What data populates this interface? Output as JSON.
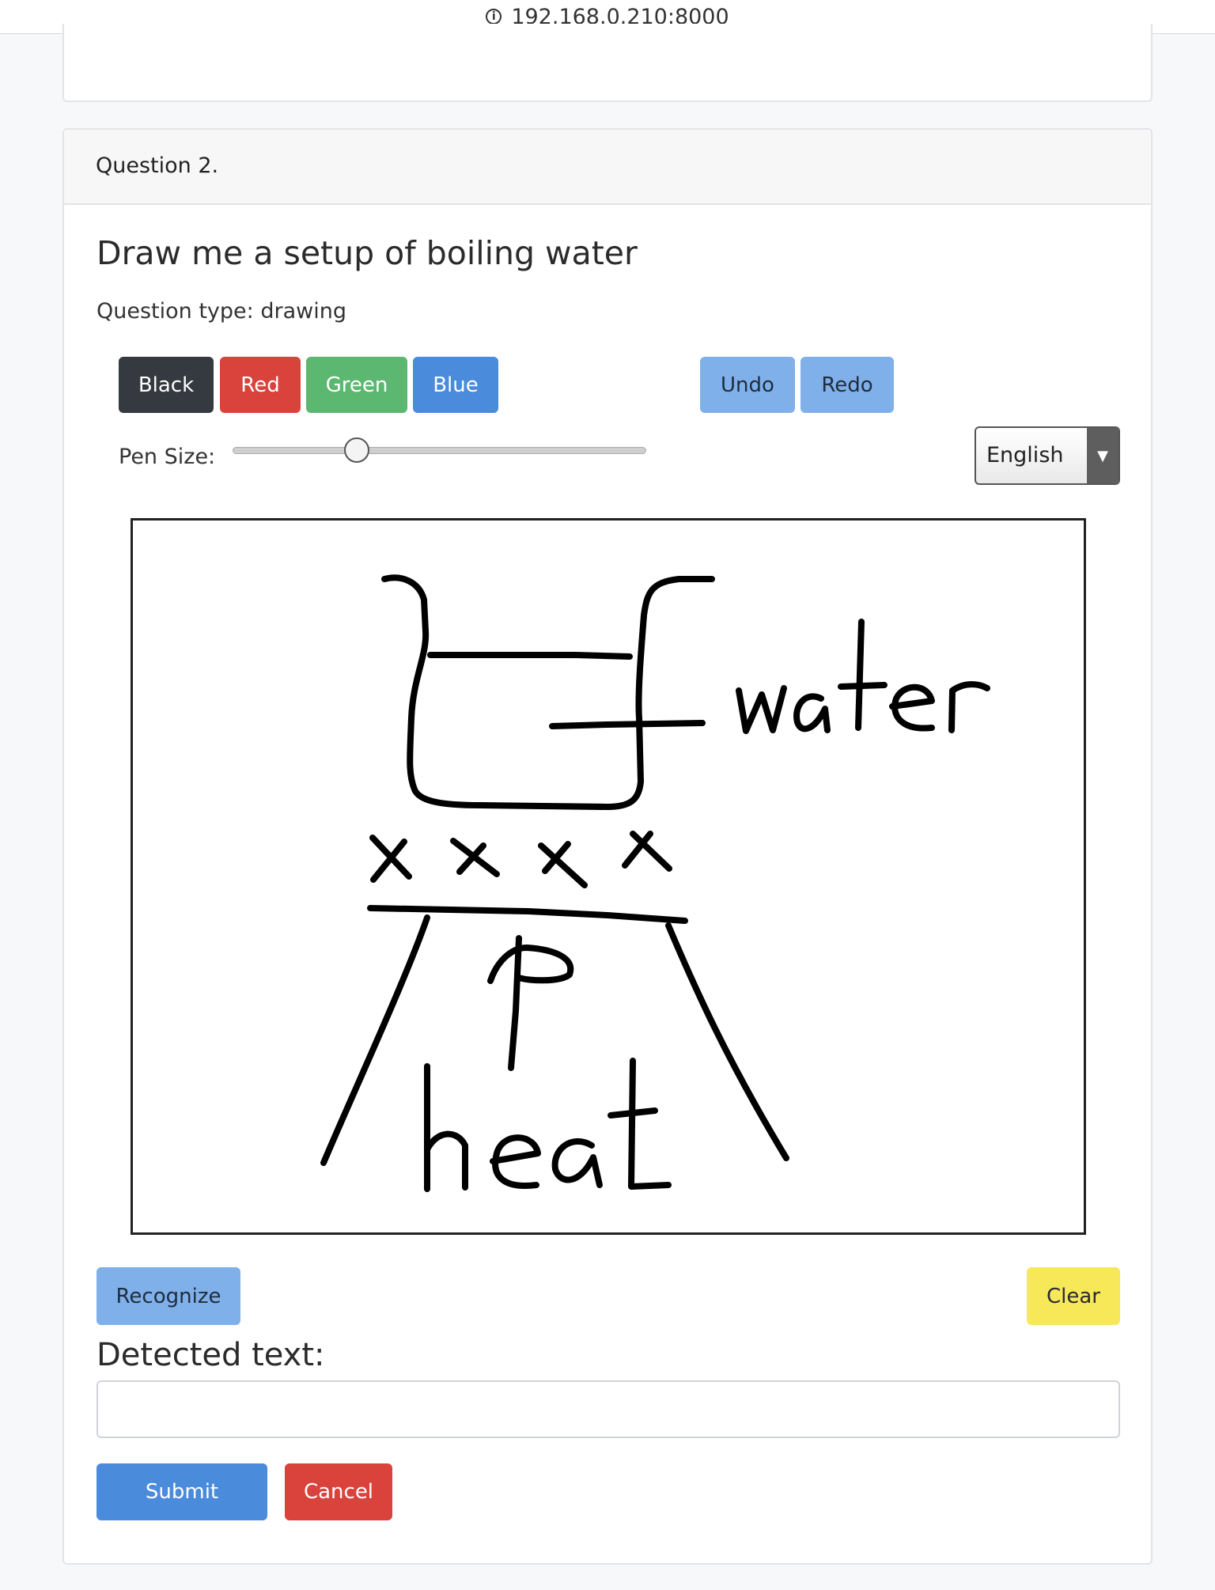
{
  "browser": {
    "url": "192.168.0.210:8000"
  },
  "question": {
    "header": "Question 2.",
    "title": "Draw me a setup of boiling water",
    "type_text": "Question type: drawing"
  },
  "toolbar": {
    "colors": [
      "Black",
      "Red",
      "Green",
      "Blue"
    ],
    "undo_label": "Undo",
    "redo_label": "Redo",
    "pen_size_label": "Pen Size:",
    "pen_size_value": 0.3
  },
  "language": {
    "selected": "English"
  },
  "drawing": {
    "labels": [
      "water",
      "heat"
    ]
  },
  "actions": {
    "recognize_label": "Recognize",
    "clear_label": "Clear",
    "detected_label": "Detected text:",
    "detected_value": "",
    "submit_label": "Submit",
    "cancel_label": "Cancel"
  },
  "colors": {
    "black": "#343a40",
    "red": "#d9433c",
    "green": "#5cb870",
    "blue": "#4a8bdc",
    "light_blue": "#7fb0ea",
    "yellow": "#f7e85a"
  }
}
